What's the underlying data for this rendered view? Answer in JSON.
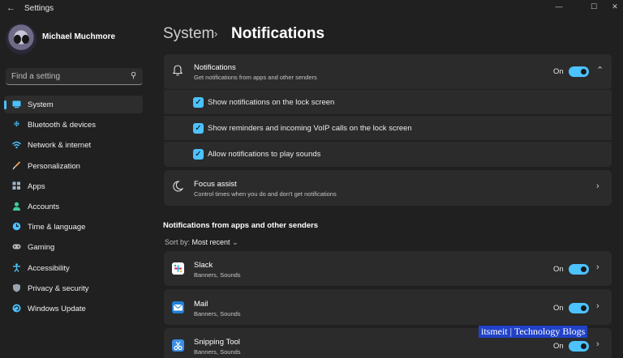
{
  "window": {
    "title": "Settings",
    "back_icon": "arrow-left-icon",
    "controls": [
      "—",
      "☐",
      "✕"
    ]
  },
  "profile": {
    "name": "Michael Muchmore"
  },
  "search": {
    "placeholder": "Find a setting",
    "icon": "search-icon"
  },
  "sidebar": {
    "items": [
      {
        "label": "System",
        "icon": "monitor-icon",
        "color": "#4cc2ff",
        "active": true
      },
      {
        "label": "Bluetooth & devices",
        "icon": "bluetooth-icon",
        "color": "#4cc2ff"
      },
      {
        "label": "Network & internet",
        "icon": "wifi-icon",
        "color": "#4cc2ff"
      },
      {
        "label": "Personalization",
        "icon": "brush-icon",
        "color": "#f2a65a"
      },
      {
        "label": "Apps",
        "icon": "apps-icon",
        "color": "#a0b4c8"
      },
      {
        "label": "Accounts",
        "icon": "person-icon",
        "color": "#3fc9a0"
      },
      {
        "label": "Time & language",
        "icon": "globe-clock-icon",
        "color": "#4cc2ff"
      },
      {
        "label": "Gaming",
        "icon": "gamepad-icon",
        "color": "#b8b8b8"
      },
      {
        "label": "Accessibility",
        "icon": "accessibility-icon",
        "color": "#4cc2ff"
      },
      {
        "label": "Privacy & security",
        "icon": "shield-icon",
        "color": "#9aa4b0"
      },
      {
        "label": "Windows Update",
        "icon": "update-icon",
        "color": "#4cc2ff"
      }
    ]
  },
  "breadcrumb": {
    "parent": "System",
    "separator": "›",
    "current": "Notifications"
  },
  "notifications": {
    "title": "Notifications",
    "subtitle": "Get notifications from apps and other senders",
    "toggle_label": "On",
    "toggle_on": true,
    "options": [
      {
        "label": "Show notifications on the lock screen",
        "checked": true
      },
      {
        "label": "Show reminders and incoming VoIP calls on the lock screen",
        "checked": true
      },
      {
        "label": "Allow notifications to play sounds",
        "checked": true
      }
    ]
  },
  "focus_assist": {
    "title": "Focus assist",
    "subtitle": "Control times when you do and don't get notifications"
  },
  "senders": {
    "section_title": "Notifications from apps and other senders",
    "sort_label": "Sort by:",
    "sort_value": "Most recent",
    "apps": [
      {
        "name": "Slack",
        "detail": "Banners, Sounds",
        "toggle_label": "On",
        "toggle_on": true,
        "icon": "slack-icon"
      },
      {
        "name": "Mail",
        "detail": "Banners, Sounds",
        "toggle_label": "On",
        "toggle_on": true,
        "icon": "mail-icon"
      },
      {
        "name": "Snipping Tool",
        "detail": "Banners, Sounds",
        "toggle_label": "On",
        "toggle_on": true,
        "icon": "snipping-tool-icon"
      }
    ]
  },
  "watermark": {
    "text": "itsmeit | Technology Blogs"
  },
  "colors": {
    "accent": "#4cc2ff",
    "background": "#202020",
    "card": "#2b2b2b"
  }
}
